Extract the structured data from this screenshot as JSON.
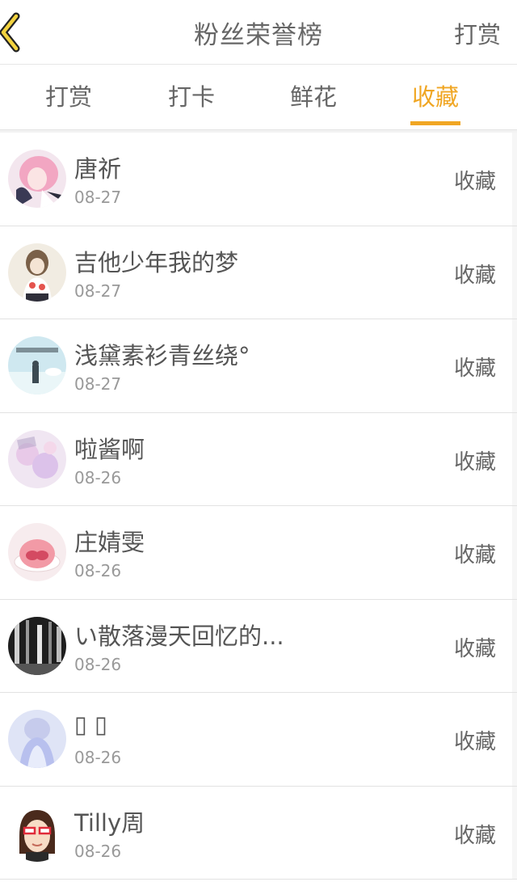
{
  "header": {
    "title": "粉丝荣誉榜",
    "right_label": "打赏"
  },
  "tabs": [
    {
      "label": "打赏",
      "active": false
    },
    {
      "label": "打卡",
      "active": false
    },
    {
      "label": "鲜花",
      "active": false
    },
    {
      "label": "收藏",
      "active": true
    }
  ],
  "colors": {
    "accent": "#f0a623"
  },
  "fans": [
    {
      "name": "唐祈",
      "date": "08-27",
      "action": "收藏"
    },
    {
      "name": "吉他少年我的梦",
      "date": "08-27",
      "action": "收藏"
    },
    {
      "name": "浅黛素衫青丝绕°",
      "date": "08-27",
      "action": "收藏"
    },
    {
      "name": "啦酱啊",
      "date": "08-26",
      "action": "收藏"
    },
    {
      "name": "庄婧雯",
      "date": "08-26",
      "action": "收藏"
    },
    {
      "name": "い散落漫天回忆的...",
      "date": "08-26",
      "action": "收藏"
    },
    {
      "name": "▯ ▯",
      "date": "08-26",
      "action": "收藏"
    },
    {
      "name": "Tilly周",
      "date": "08-26",
      "action": "收藏"
    }
  ]
}
